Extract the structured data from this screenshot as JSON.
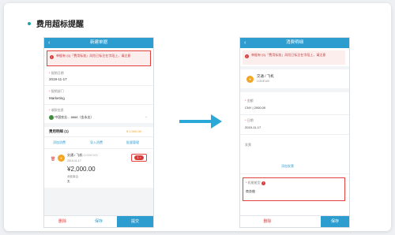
{
  "section_title": "费用超标提醒",
  "left": {
    "header_title": "新建单据",
    "alert": "单据有“{0}「费用标准」风险已标注在字段上，请注意",
    "fields": {
      "report_date_label": "报销日期",
      "report_date_value": "2019-11-17",
      "dept_label": "报销部门",
      "dept_value": "Marketing",
      "payee_label": "收款信息",
      "payee_value": "中国农业...     8888（金永志）"
    },
    "expense": {
      "title": "费用明细",
      "count": "(1)",
      "total": "¥ 2,000.00",
      "add": "添加消费",
      "import": "导入消费",
      "batch": "批量管理",
      "item_name": "交通 / 飞机",
      "item_code": "CODE100",
      "item_date": "2019-11-17",
      "item_amount": "¥2,000.00",
      "item_type_label": "消费事由",
      "item_type_value": "无",
      "badge": "1"
    },
    "footer": {
      "delete": "删除",
      "save": "保存",
      "submit": "提交"
    }
  },
  "right": {
    "header_title": "消费明细",
    "alert": "单据有“{0}「费用标准」风险已标注在字段上，请注意",
    "item_name": "交通 / 飞机",
    "item_code": "CODE100",
    "amount_label": "金额",
    "amount_currency": "CNY",
    "amount_value": "2000.00",
    "date_label": "日期",
    "date_value": "2019-11-17",
    "invoice_label": "发票",
    "add_invoice": "添加发票",
    "cabin_label": "机舱舱型",
    "cabin_value": "商务舱",
    "footer": {
      "delete": "删除",
      "save": "保存"
    }
  }
}
